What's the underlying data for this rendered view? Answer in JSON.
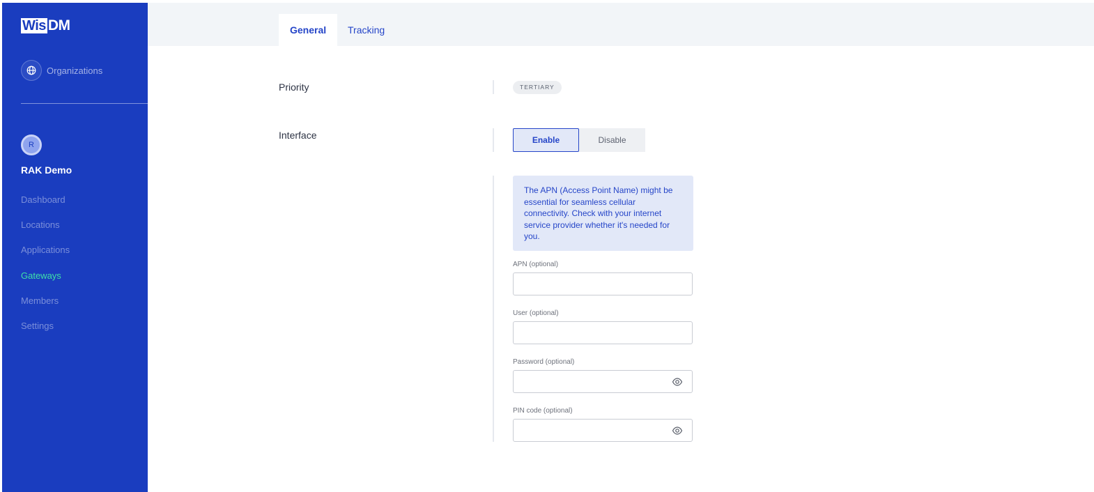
{
  "brand": {
    "logo_box": "Wis",
    "logo_text": "DM"
  },
  "sidebar": {
    "organizations_label": "Organizations",
    "avatar_initial": "R",
    "org_name": "RAK Demo",
    "items": [
      {
        "label": "Dashboard"
      },
      {
        "label": "Locations"
      },
      {
        "label": "Applications"
      },
      {
        "label": "Gateways",
        "active": true
      },
      {
        "label": "Members"
      },
      {
        "label": "Settings"
      }
    ]
  },
  "tabs": [
    {
      "label": "General",
      "active": true
    },
    {
      "label": "Tracking"
    }
  ],
  "form": {
    "priority_label": "Priority",
    "priority_value": "TERTIARY",
    "interface_label": "Interface",
    "interface_options": {
      "enable": "Enable",
      "disable": "Disable",
      "selected": "Enable"
    },
    "info_text": "The APN (Access Point Name) might be essential for seamless cellular connectivity. Check with your internet service provider whether it's needed for you.",
    "fields": [
      {
        "label": "APN (optional)",
        "value": ""
      },
      {
        "label": "User (optional)",
        "value": ""
      },
      {
        "label": "Password (optional)",
        "value": "",
        "icon": "eye-icon"
      },
      {
        "label": "PIN code (optional)",
        "value": "",
        "icon": "eye-icon"
      }
    ]
  },
  "colors": {
    "sidebar_bg": "#1a3dbf",
    "accent": "#2545c8",
    "active_nav": "#3ee0a8",
    "info_bg": "#e2e8f8"
  }
}
